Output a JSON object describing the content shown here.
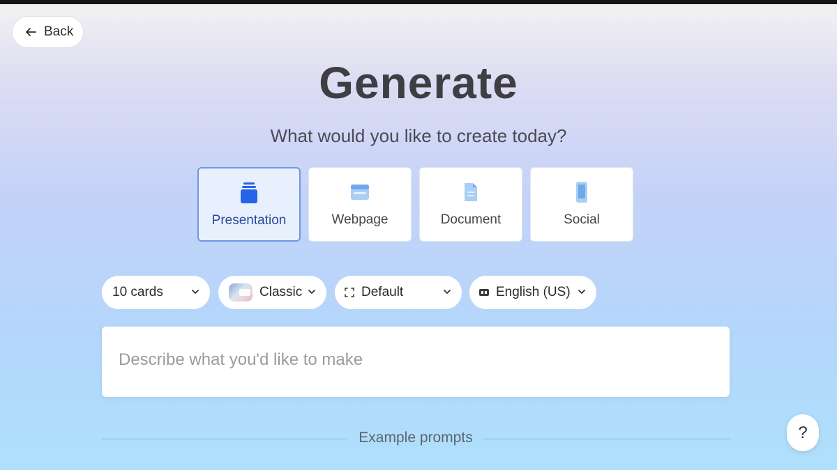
{
  "nav": {
    "back_label": "Back"
  },
  "header": {
    "title": "Generate",
    "subtitle": "What would you like to create today?"
  },
  "types": [
    {
      "label": "Presentation",
      "icon": "presentation-icon",
      "selected": true
    },
    {
      "label": "Webpage",
      "icon": "webpage-icon",
      "selected": false
    },
    {
      "label": "Document",
      "icon": "document-icon",
      "selected": false
    },
    {
      "label": "Social",
      "icon": "social-icon",
      "selected": false
    }
  ],
  "options": {
    "cards": "10 cards",
    "theme": "Classic",
    "layout": "Default",
    "language": "English (US)"
  },
  "prompt": {
    "placeholder": "Describe what you'd like to make"
  },
  "examples_label": "Example prompts",
  "help_label": "?",
  "colors": {
    "accent": "#2563eb",
    "selected_border": "#6f97e4",
    "selected_bg": "#e9f0fd",
    "icon_light": "#9ec8f5"
  }
}
